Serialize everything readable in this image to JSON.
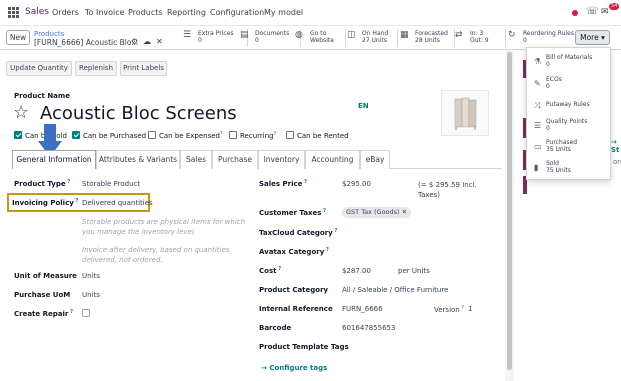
{
  "nav": {
    "brand": "Sales",
    "menu": [
      "Orders",
      "To Invoice",
      "Products",
      "Reporting",
      "Configuration",
      "My model"
    ],
    "notification_count": "54"
  },
  "control": {
    "new_label": "New",
    "breadcrumb_parent": "Products",
    "breadcrumb_current": "[FURN_6666] Acoustic Blo...",
    "more_label": "More",
    "stats": [
      {
        "icon": "extra-prices-icon",
        "line1": "Extra Prices",
        "line2": "0"
      },
      {
        "icon": "documents-icon",
        "line1": "Documents",
        "line2": "0"
      },
      {
        "icon": "globe-icon",
        "line1": "Go to",
        "line2": "Website"
      },
      {
        "icon": "on-hand-icon",
        "line1": "On Hand",
        "line2": "27 Units"
      },
      {
        "icon": "forecasted-icon",
        "line1": "Forecasted",
        "line2": "28 Units"
      },
      {
        "icon": "in-out-icon",
        "line1": "In: 3",
        "line2": "Out: 9"
      },
      {
        "icon": "refresh-icon",
        "line1": "Reordering Rules",
        "line2": "0"
      }
    ]
  },
  "actions": [
    "Update Quantity",
    "Replenish",
    "Print Labels"
  ],
  "product": {
    "name_label": "Product Name",
    "name": "Acoustic Bloc Screens",
    "lang": "EN",
    "checkboxes": [
      {
        "label": "Can be Sold",
        "checked": true
      },
      {
        "label": "Can be Purchased",
        "checked": true
      },
      {
        "label": "Can be Expensed",
        "checked": false
      },
      {
        "label": "Recurring",
        "checked": false
      },
      {
        "label": "Can be Rented",
        "checked": false
      }
    ]
  },
  "tabs": [
    "General Information",
    "Attributes & Variants",
    "Sales",
    "Purchase",
    "Inventory",
    "Accounting",
    "eBay"
  ],
  "fields_left": {
    "product_type_label": "Product Type",
    "product_type": "Storable Product",
    "invoicing_policy_label": "Invoicing Policy",
    "invoicing_policy": "Delivered quantities",
    "help1": "Storable products are physical items for which you manage the inventory level.",
    "help2": "Invoice after delivery, based on quantities delivered, not ordered.",
    "uom_label": "Unit of Measure",
    "uom": "Units",
    "purchase_uom_label": "Purchase UoM",
    "purchase_uom": "Units",
    "create_repair_label": "Create Repair"
  },
  "fields_right": {
    "sales_price_label": "Sales Price",
    "sales_price": "$295.00",
    "sales_price_incl": "(= $ 295.59 Incl. Taxes)",
    "customer_taxes_label": "Customer Taxes",
    "customer_taxes_chip": "GST Tax (Goods)",
    "taxcloud_label": "TaxCloud Category",
    "avatax_label": "Avatax Category",
    "cost_label": "Cost",
    "cost": "$287.00",
    "cost_unit": "per Units",
    "category_label": "Product Category",
    "category": "All / Saleable / Office Furniture",
    "internal_ref_label": "Internal Reference",
    "internal_ref": "FURN_6666",
    "version_label": "Version",
    "version": "1",
    "barcode_label": "Barcode",
    "barcode": "601647855653",
    "template_tags_label": "Product Template Tags",
    "configure_tags": "Configure tags"
  },
  "dropdown": [
    {
      "icon": "flask-icon",
      "line1": "Bill of Materials",
      "line2": "0"
    },
    {
      "icon": "wrench-icon",
      "line1": "ECOs",
      "line2": "0"
    },
    {
      "icon": "random-icon",
      "line1": "Putaway Rules",
      "line2": ""
    },
    {
      "icon": "list-icon",
      "line1": "Quality Points",
      "line2": "0"
    },
    {
      "icon": "credit-card-icon",
      "line1": "Purchased",
      "line2": "35 Units"
    },
    {
      "icon": "bar-chart-icon",
      "line1": "Sold",
      "line2": "75 Units"
    }
  ],
  "chatter_peek": {
    "arrow_text": "→ St",
    "fragment": "ore"
  },
  "colors": {
    "accent": "#017e84",
    "brand": "#4c1d55",
    "highlight_border": "#c59a12",
    "annotation_arrow": "#3a6fc1"
  }
}
